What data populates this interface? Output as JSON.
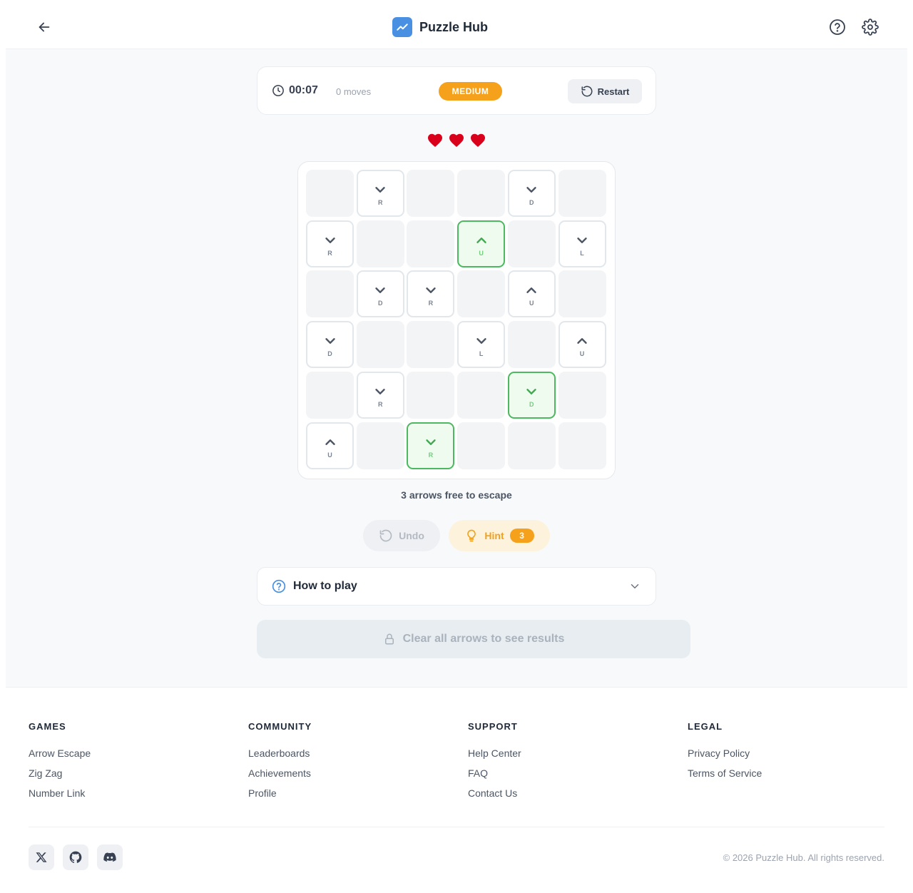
{
  "header": {
    "brand_name": "Puzzle Hub",
    "brand_color": "#4a90e2"
  },
  "status": {
    "timer": "00:07",
    "moves": "0 moves",
    "difficulty": "MEDIUM",
    "restart_label": "Restart"
  },
  "lives": {
    "remaining": 3,
    "max": 3,
    "color": "#d9001b"
  },
  "board": {
    "rows": 6,
    "cols": 6,
    "cells": [
      [
        "",
        "R",
        "",
        "",
        "D",
        ""
      ],
      [
        "R",
        "",
        "",
        "U",
        "",
        "L"
      ],
      [
        "",
        "D",
        "R",
        "",
        "U",
        ""
      ],
      [
        "D",
        "",
        "",
        "L",
        "",
        "U"
      ],
      [
        "",
        "R",
        "",
        "",
        "D",
        ""
      ],
      [
        "U",
        "",
        "R",
        "",
        "",
        ""
      ]
    ],
    "glyphs": [
      [
        "",
        "down",
        "",
        "",
        "down",
        ""
      ],
      [
        "down",
        "",
        "",
        "up",
        "",
        "down"
      ],
      [
        "",
        "down",
        "down",
        "",
        "up",
        ""
      ],
      [
        "down",
        "",
        "",
        "down",
        "",
        "up"
      ],
      [
        "",
        "down",
        "",
        "",
        "down",
        ""
      ],
      [
        "up",
        "",
        "down",
        "",
        "",
        ""
      ]
    ],
    "free_cells": [
      [
        1,
        3
      ],
      [
        4,
        4
      ],
      [
        5,
        2
      ]
    ]
  },
  "free_text": "3 arrows free to escape",
  "actions": {
    "undo_label": "Undo",
    "hint_label": "Hint",
    "hint_count": "3"
  },
  "how_to_play": {
    "title": "How to play"
  },
  "results": {
    "label": "Clear all arrows to see results"
  },
  "footer": {
    "columns": [
      {
        "title": "GAMES",
        "links": [
          "Arrow Escape",
          "Zig Zag",
          "Number Link"
        ]
      },
      {
        "title": "COMMUNITY",
        "links": [
          "Leaderboards",
          "Achievements",
          "Profile"
        ]
      },
      {
        "title": "SUPPORT",
        "links": [
          "Help Center",
          "FAQ",
          "Contact Us"
        ]
      },
      {
        "title": "LEGAL",
        "links": [
          "Privacy Policy",
          "Terms of Service"
        ]
      }
    ],
    "socials": [
      "x-icon",
      "github-icon",
      "discord-icon"
    ],
    "copyright": "© 2026 Puzzle Hub. All rights reserved."
  }
}
